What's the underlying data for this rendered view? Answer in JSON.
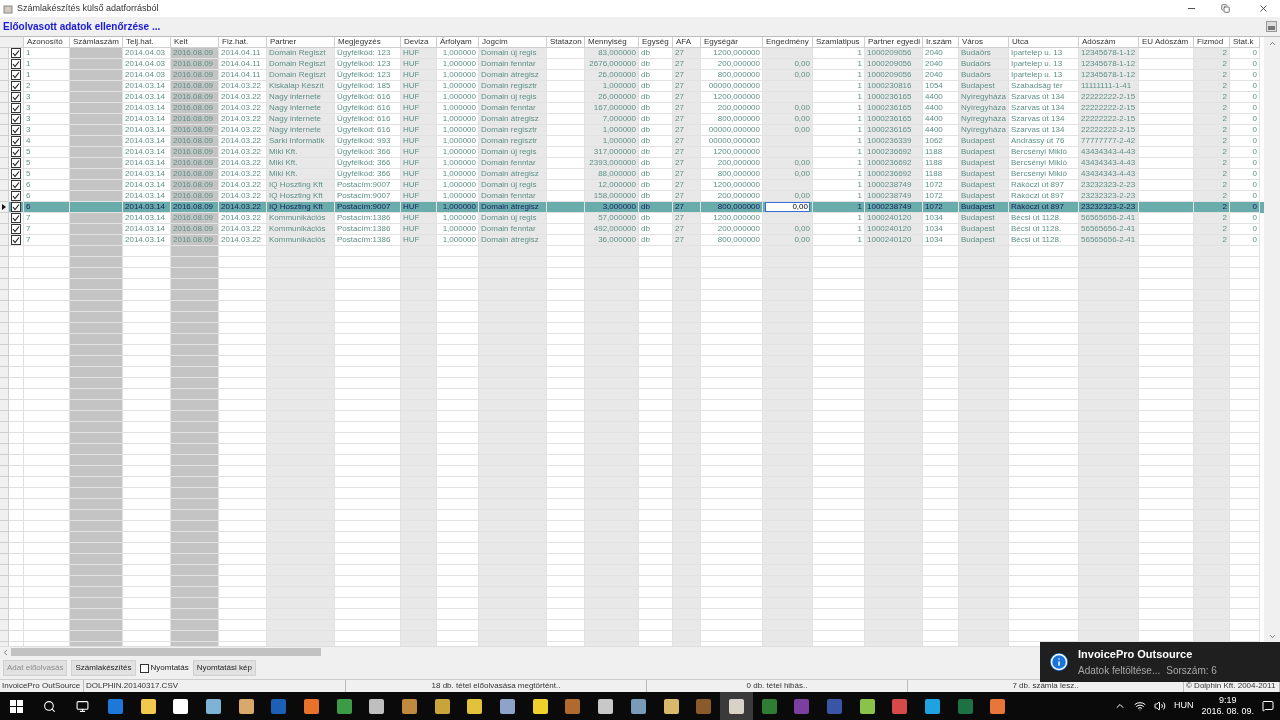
{
  "window": {
    "title": "Számlakészítés külső adatforrásból"
  },
  "heading": "Előolvasott adatok ellenőrzése ...",
  "table": {
    "columns": [
      {
        "label": "Azonosító",
        "kind": "plain"
      },
      {
        "label": "Számlaszám",
        "kind": "dark"
      },
      {
        "label": "Telj.hat.",
        "kind": "plain"
      },
      {
        "label": "Kelt",
        "kind": "dark"
      },
      {
        "label": "Fiz.hat.",
        "kind": "plain"
      },
      {
        "label": "Partner",
        "kind": "light"
      },
      {
        "label": "Megjegyzés",
        "kind": "plain"
      },
      {
        "label": "Deviza",
        "kind": "light"
      },
      {
        "label": "Árfolyam",
        "kind": "plain"
      },
      {
        "label": "Jogcím",
        "kind": "light"
      },
      {
        "label": "Statazon",
        "kind": "plain"
      },
      {
        "label": "Mennyiség",
        "kind": "light"
      },
      {
        "label": "Egység",
        "kind": "plain"
      },
      {
        "label": "AFA",
        "kind": "light"
      },
      {
        "label": "Egységár",
        "kind": "plain"
      },
      {
        "label": "Engedmény",
        "kind": "light"
      },
      {
        "label": "Szamlatipus",
        "kind": "plain"
      },
      {
        "label": "Partner egyedi",
        "kind": "light"
      },
      {
        "label": "Ir.szám",
        "kind": "plain"
      },
      {
        "label": "Város",
        "kind": "light"
      },
      {
        "label": "Utca",
        "kind": "plain"
      },
      {
        "label": "Adószám",
        "kind": "light"
      },
      {
        "label": "EU Adószám",
        "kind": "plain"
      },
      {
        "label": "Fizmód",
        "kind": "light"
      },
      {
        "label": "Stat.k",
        "kind": "plain"
      }
    ],
    "rows": [
      {
        "checked": true,
        "selected": false,
        "cells": [
          "1",
          null,
          "2014.04.03",
          "2016.08.09",
          "2014.04.11",
          "Domain Regiszt",
          "Ügyfélkód: 123",
          "HUF",
          "1,000000",
          "Domain új regis",
          null,
          "83,000000",
          "db",
          "27",
          "1200,000000",
          null,
          "1",
          "1000209056",
          "2040",
          "Budaörs",
          "Ipartelep u. 13",
          "12345678-1-12",
          null,
          "2",
          "0"
        ]
      },
      {
        "checked": true,
        "selected": false,
        "cells": [
          "1",
          null,
          "2014.04.03",
          "2016.08.09",
          "2014.04.11",
          "Domain Regiszt",
          "Ügyfélkód: 123",
          "HUF",
          "1,000000",
          "Domain fenntar",
          null,
          "2676,000000",
          "db",
          "27",
          "200,000000",
          "0,00",
          "1",
          "1000209056",
          "2040",
          "Budaörs",
          "Ipartelep u. 13",
          "12345678-1-12",
          null,
          "2",
          "0"
        ]
      },
      {
        "checked": true,
        "selected": false,
        "cells": [
          "1",
          null,
          "2014.04.03",
          "2016.08.09",
          "2014.04.11",
          "Domain Regiszt",
          "Ügyfélkód: 123",
          "HUF",
          "1,000000",
          "Domain átregisz",
          null,
          "26,000000",
          "db",
          "27",
          "800,000000",
          "0,00",
          "1",
          "1000209056",
          "2040",
          "Budaörs",
          "Ipartelep u. 13",
          "12345678-1-12",
          null,
          "2",
          "0"
        ]
      },
      {
        "checked": true,
        "selected": false,
        "cells": [
          "2",
          null,
          "2014.03.14",
          "2016.08.09",
          "2014.03.22",
          "Kiskalap Készít",
          "Ügyfélkód: 185",
          "HUF",
          "1,000000",
          "Domain regisztr",
          null,
          "1,000000",
          "db",
          "27",
          "00000,000000",
          null,
          "1",
          "1000230816",
          "1054",
          "Budapest",
          "Szabadság tér",
          "11111111-1-41",
          null,
          "2",
          "0"
        ]
      },
      {
        "checked": true,
        "selected": false,
        "cells": [
          "3",
          null,
          "2014.03.14",
          "2016.08.09",
          "2014.03.22",
          "Nagy internete",
          "Ügyfélkód: 616",
          "HUF",
          "1,000000",
          "Domain új regis",
          null,
          "26,000000",
          "db",
          "27",
          "1200,000000",
          null,
          "1",
          "1000236165",
          "4400",
          "Nyíregyháza",
          "Szarvas út 134",
          "22222222-2-15",
          null,
          "2",
          "0"
        ]
      },
      {
        "checked": true,
        "selected": false,
        "cells": [
          "3",
          null,
          "2014.03.14",
          "2016.08.09",
          "2014.03.22",
          "Nagy internete",
          "Ügyfélkód: 616",
          "HUF",
          "1,000000",
          "Domain fenntar",
          null,
          "167,000000",
          "db",
          "27",
          "200,000000",
          "0,00",
          "1",
          "1000236165",
          "4400",
          "Nyíregyháza",
          "Szarvas út 134",
          "22222222-2-15",
          null,
          "2",
          "0"
        ]
      },
      {
        "checked": true,
        "selected": false,
        "cells": [
          "3",
          null,
          "2014.03.14",
          "2016.08.09",
          "2014.03.22",
          "Nagy internete",
          "Ügyfélkód: 616",
          "HUF",
          "1,000000",
          "Domain átregisz",
          null,
          "7,000000",
          "db",
          "27",
          "800,000000",
          "0,00",
          "1",
          "1000236165",
          "4400",
          "Nyíregyháza",
          "Szarvas út 134",
          "22222222-2-15",
          null,
          "2",
          "0"
        ]
      },
      {
        "checked": true,
        "selected": false,
        "cells": [
          "3",
          null,
          "2014.03.14",
          "2016.08.09",
          "2014.03.22",
          "Nagy internete",
          "Ügyfélkód: 616",
          "HUF",
          "1,000000",
          "Domain regisztr",
          null,
          "1,000000",
          "db",
          "27",
          "00000,000000",
          "0,00",
          "1",
          "1000236165",
          "4400",
          "Nyíregyháza",
          "Szarvas út 134",
          "22222222-2-15",
          null,
          "2",
          "0"
        ]
      },
      {
        "checked": true,
        "selected": false,
        "cells": [
          "4",
          null,
          "2014.03.14",
          "2016.08.09",
          "2014.03.22",
          "Sarki Informatik",
          "Ügyfélkód: 993",
          "HUF",
          "1,000000",
          "Domain regisztr",
          null,
          "1,000000",
          "db",
          "27",
          "00000,000000",
          null,
          "1",
          "1000236339",
          "1062",
          "Budapest",
          "Andrássy út 76",
          "77777777-2-42",
          null,
          "2",
          "0"
        ]
      },
      {
        "checked": true,
        "selected": false,
        "cells": [
          "5",
          null,
          "2014.03.14",
          "2016.08.09",
          "2014.03.22",
          "Miki Kft.",
          "Ügyfélkód: 366",
          "HUF",
          "1,000000",
          "Domain új regis",
          null,
          "317,000000",
          "db",
          "27",
          "1200,000000",
          null,
          "1",
          "1000236692",
          "1188",
          "Budapest",
          "Bercsényi Mikló",
          "43434343-4-43",
          null,
          "2",
          "0"
        ]
      },
      {
        "checked": true,
        "selected": false,
        "cells": [
          "5",
          null,
          "2014.03.14",
          "2016.08.09",
          "2014.03.22",
          "Miki Kft.",
          "Ügyfélkód: 366",
          "HUF",
          "1,000000",
          "Domain fenntar",
          null,
          "2393,000000",
          "db",
          "27",
          "200,000000",
          "0,00",
          "1",
          "1000236692",
          "1188",
          "Budapest",
          "Bercsényi Mikló",
          "43434343-4-43",
          null,
          "2",
          "0"
        ]
      },
      {
        "checked": true,
        "selected": false,
        "cells": [
          "5",
          null,
          "2014.03.14",
          "2016.08.09",
          "2014.03.22",
          "Miki Kft.",
          "Ügyfélkód: 366",
          "HUF",
          "1,000000",
          "Domain átregisz",
          null,
          "88,000000",
          "db",
          "27",
          "800,000000",
          "0,00",
          "1",
          "1000236692",
          "1188",
          "Budapest",
          "Bercsényi Mikló",
          "43434343-4-43",
          null,
          "2",
          "0"
        ]
      },
      {
        "checked": true,
        "selected": false,
        "cells": [
          "6",
          null,
          "2014.03.14",
          "2016.08.09",
          "2014.03.22",
          "IQ Hoszting Kft",
          "Postacím:9007",
          "HUF",
          "1,000000",
          "Domain új regis",
          null,
          "12,000000",
          "db",
          "27",
          "1200,000000",
          null,
          "1",
          "1000238749",
          "1072",
          "Budapest",
          "Rákóczi út 897",
          "23232323-2-23",
          null,
          "2",
          "0"
        ]
      },
      {
        "checked": true,
        "selected": false,
        "cells": [
          "6",
          null,
          "2014.03.14",
          "2016.08.09",
          "2014.03.22",
          "IQ Hoszting Kft",
          "Postacím:9007",
          "HUF",
          "1,000000",
          "Domain fenntar",
          null,
          "158,000000",
          "db",
          "27",
          "200,000000",
          "0,00",
          "1",
          "1000238749",
          "1072",
          "Budapest",
          "Rákóczi út 897",
          "23232323-2-23",
          null,
          "2",
          "0"
        ]
      },
      {
        "checked": true,
        "selected": true,
        "cells": [
          "6",
          null,
          "2014.03.14",
          "2016.08.09",
          "2014.03.22",
          "IQ Hoszting Kft",
          "Postacím:9007",
          "HUF",
          "1,000000",
          "Domain átregisz",
          null,
          "3,000000",
          "db",
          "27",
          "800,000000",
          {
            "text": "0,00",
            "editing": true
          },
          "1",
          "1000238749",
          "1072",
          "Budapest",
          "Rákóczi út 897",
          "23232323-2-23",
          null,
          "2",
          "0"
        ]
      },
      {
        "checked": true,
        "selected": false,
        "cells": [
          "7",
          null,
          "2014.03.14",
          "2016.08.09",
          "2014.03.22",
          "Kommunikációs",
          "Postacím:1386",
          "HUF",
          "1,000000",
          "Domain új regis",
          null,
          "57,000000",
          "db",
          "27",
          "1200,000000",
          null,
          "1",
          "1000240120",
          "1034",
          "Budapest",
          "Bécsi út 1128.",
          "56565656-2-41",
          null,
          "2",
          "0"
        ]
      },
      {
        "checked": true,
        "selected": false,
        "cells": [
          "7",
          null,
          "2014.03.14",
          "2016.08.09",
          "2014.03.22",
          "Kommunikációs",
          "Postacím:1386",
          "HUF",
          "1,000000",
          "Domain fenntar",
          null,
          "492,000000",
          "db",
          "27",
          "200,000000",
          "0,00",
          "1",
          "1000240120",
          "1034",
          "Budapest",
          "Bécsi út 1128.",
          "56565656-2-41",
          null,
          "2",
          "0"
        ]
      },
      {
        "checked": true,
        "selected": false,
        "cells": [
          "7",
          null,
          "2014.03.14",
          "2016.08.09",
          "2014.03.22",
          "Kommunikációs",
          "Postacím:1386",
          "HUF",
          "1,000000",
          "Domain átregisz",
          null,
          "36,000000",
          "db",
          "27",
          "800,000000",
          "0,00",
          "1",
          "1000240120",
          "1034",
          "Budapest",
          "Bécsi út 1128.",
          "56565656-2-41",
          null,
          "2",
          "0"
        ]
      }
    ]
  },
  "controls": [
    {
      "kind": "button",
      "label": "Adat előolvasás",
      "disabled": true
    },
    {
      "kind": "button",
      "label": "Számlakészítés",
      "disabled": false
    },
    {
      "kind": "checkbox",
      "label": "Nyomtatás",
      "checked": false
    },
    {
      "kind": "button",
      "label": "Nyomtatási kép",
      "disabled": false
    }
  ],
  "status_bar": [
    "InvoicePro OutSource",
    "DOLPHIN.20140317.CSV",
    "18 db. tétel előolvasása megtörtént..",
    "0 db. tétel hibás..",
    "7 db. számla lesz..",
    "© Dolphin Kft. 2004-2011"
  ],
  "notification": {
    "title": "InvoicePro Outsource",
    "message": "Adatok feltöltése...",
    "detail": "Sorszám: 6"
  },
  "taskbar": {
    "language": "HUN",
    "time": "9:19",
    "date": "2016. 08. 09."
  }
}
